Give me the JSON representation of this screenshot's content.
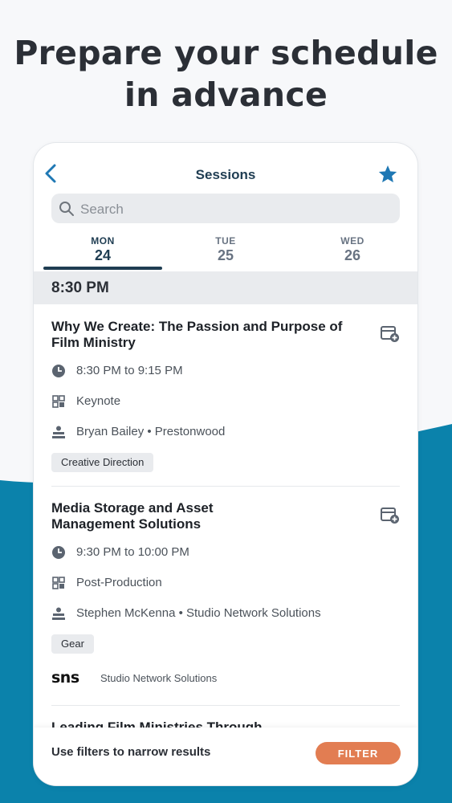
{
  "headline": {
    "line1": "Prepare your schedule",
    "line2": "in advance"
  },
  "screen": {
    "title": "Sessions",
    "search_placeholder": "Search",
    "days": [
      {
        "name": "MON",
        "num": "24"
      },
      {
        "name": "TUE",
        "num": "25"
      },
      {
        "name": "WED",
        "num": "26"
      }
    ],
    "time_header": "8:30 PM",
    "sessions": [
      {
        "title": "Why We Create: The Passion and Purpose of Film Ministry",
        "time": "8:30 PM to 9:15 PM",
        "type": "Keynote",
        "speaker": "Bryan Bailey • Prestonwood",
        "tag": "Creative Direction"
      },
      {
        "title": "Media Storage and Asset Management Solutions",
        "time": "9:30 PM to 10:00 PM",
        "type": "Post-Production",
        "speaker": "Stephen McKenna • Studio Network Solutions",
        "tag": "Gear",
        "sponsor_logo": "sns",
        "sponsor_name": "Studio Network Solutions"
      },
      {
        "title": "Leading Film Ministries Through"
      }
    ],
    "footer_text": "Use filters to narrow results",
    "filter_label": "FILTER"
  },
  "colors": {
    "accent": "#1f3d52",
    "wave": "#0b82ab",
    "filter": "#e27d52",
    "star": "#1f78b4"
  }
}
